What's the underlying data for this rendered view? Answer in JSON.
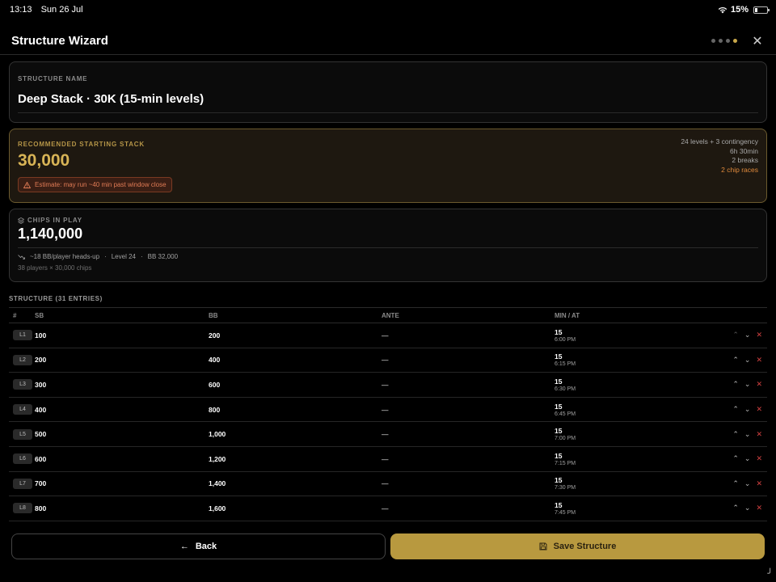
{
  "status_bar": {
    "time": "13:13",
    "date": "Sun 26 Jul",
    "battery": "15%"
  },
  "header": {
    "title": "Structure Wizard"
  },
  "structure_name": {
    "label": "STRUCTURE NAME",
    "value": "Deep Stack · 30K (15-min levels)"
  },
  "starting_stack": {
    "label": "RECOMMENDED STARTING STACK",
    "value": "30,000",
    "warning": "Estimate: may run ~40 min past window close",
    "stats": [
      "24 levels + 3 contingency",
      "6h 30min",
      "2 breaks"
    ],
    "stats_accent": "2 chip races"
  },
  "chips_in_play": {
    "label": "CHIPS IN PLAY",
    "value": "1,140,000",
    "meta_1": "~18 BB/player heads-up",
    "meta_2": "Level 24",
    "meta_3": "BB 32,000",
    "sub": "38 players × 30,000 chips"
  },
  "structure": {
    "title": "STRUCTURE (31 ENTRIES)",
    "columns": [
      "#",
      "SB",
      "BB",
      "ANTE",
      "MIN / AT"
    ],
    "rows": [
      {
        "level": "L1",
        "sb": "100",
        "bb": "200",
        "ante": "—",
        "min": "15",
        "at": "6:00 PM"
      },
      {
        "level": "L2",
        "sb": "200",
        "bb": "400",
        "ante": "—",
        "min": "15",
        "at": "6:15 PM"
      },
      {
        "level": "L3",
        "sb": "300",
        "bb": "600",
        "ante": "—",
        "min": "15",
        "at": "6:30 PM"
      },
      {
        "level": "L4",
        "sb": "400",
        "bb": "800",
        "ante": "—",
        "min": "15",
        "at": "6:45 PM"
      },
      {
        "level": "L5",
        "sb": "500",
        "bb": "1,000",
        "ante": "—",
        "min": "15",
        "at": "7:00 PM"
      },
      {
        "level": "L6",
        "sb": "600",
        "bb": "1,200",
        "ante": "—",
        "min": "15",
        "at": "7:15 PM"
      },
      {
        "level": "L7",
        "sb": "700",
        "bb": "1,400",
        "ante": "—",
        "min": "15",
        "at": "7:30 PM"
      },
      {
        "level": "L8",
        "sb": "800",
        "bb": "1,600",
        "ante": "—",
        "min": "15",
        "at": "7:45 PM"
      }
    ]
  },
  "footer": {
    "back_label": "Back",
    "save_label": "Save Structure"
  },
  "colors": {
    "accent": "#c9a94a",
    "warning": "#e07b55",
    "delete": "#d04040",
    "background": "#000000"
  }
}
